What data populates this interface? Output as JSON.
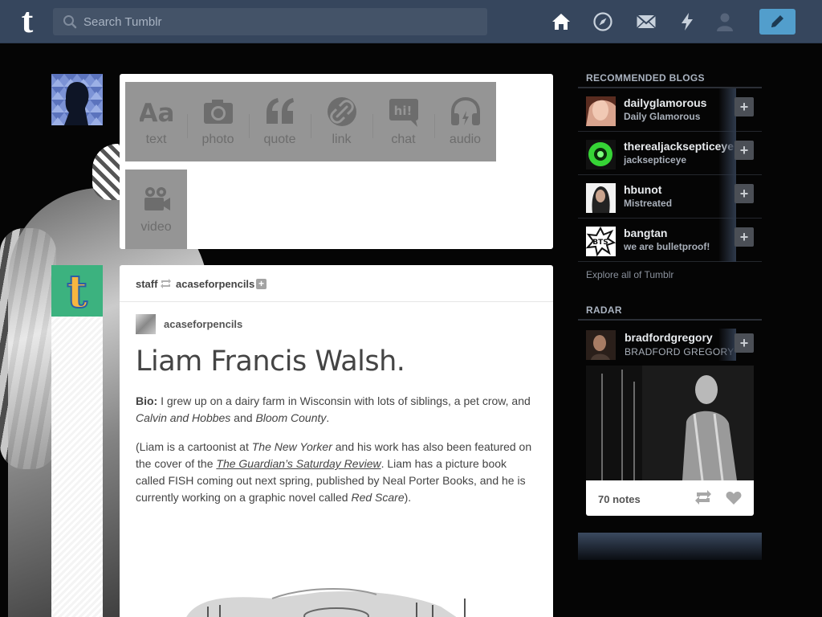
{
  "header": {
    "logo": "t",
    "search_placeholder": "Search Tumblr",
    "nav_icons": [
      "home-icon",
      "explore-icon",
      "inbox-icon",
      "activity-icon",
      "account-icon"
    ],
    "compose_icon": "pencil-icon",
    "accent_color": "#529ecc",
    "bar_color": "#36465d"
  },
  "composer": {
    "post_types": [
      {
        "label": "text",
        "icon": "text-icon"
      },
      {
        "label": "photo",
        "icon": "camera-icon"
      },
      {
        "label": "quote",
        "icon": "quote-icon"
      },
      {
        "label": "link",
        "icon": "link-icon"
      },
      {
        "label": "chat",
        "icon": "chat-icon",
        "icon_text": "hi!"
      },
      {
        "label": "audio",
        "icon": "headphones-icon"
      },
      {
        "label": "video",
        "icon": "video-camera-icon"
      }
    ]
  },
  "post": {
    "reblogger": "staff",
    "source": "acaseforpencils",
    "author": "acaseforpencils",
    "title": "Liam Francis Walsh.",
    "bio_label": "Bio:",
    "bio_text_1": " I grew up on a dairy farm in Wisconsin with lots of siblings, a pet crow, and ",
    "bio_em_1": "Calvin and Hobbes",
    "bio_text_2": " and ",
    "bio_em_2": "Bloom County",
    "bio_text_3": ".",
    "para2_text_1": "(Liam is a cartoonist at ",
    "para2_em_1": "The New Yorker",
    "para2_text_2": " and his work has also been featured on the cover of the ",
    "para2_link": "The Guardian’s Saturday Review",
    "para2_text_3": ". Liam has a picture book called FISH coming out next spring, published by Neal Porter Books, and he is currently working on a graphic novel called ",
    "para2_em_2": "Red Scare",
    "para2_text_4": ")."
  },
  "sidebar": {
    "recommended_heading": "RECOMMENDED BLOGS",
    "recommended": [
      {
        "name": "dailyglamorous",
        "title": "Daily Glamorous"
      },
      {
        "name": "therealjacksepticeye",
        "title": "jacksepticeye"
      },
      {
        "name": "hbunot",
        "title": "Mistreated"
      },
      {
        "name": "bangtan",
        "title": "we are bulletproof!"
      }
    ],
    "explore_label": "Explore all of Tumblr",
    "radar_heading": "RADAR",
    "radar": {
      "name": "bradfordgregory",
      "title": "BRADFORD GREGORY",
      "notes": "70 notes"
    },
    "follow_label": "+",
    "bts_badge": "BTS"
  }
}
